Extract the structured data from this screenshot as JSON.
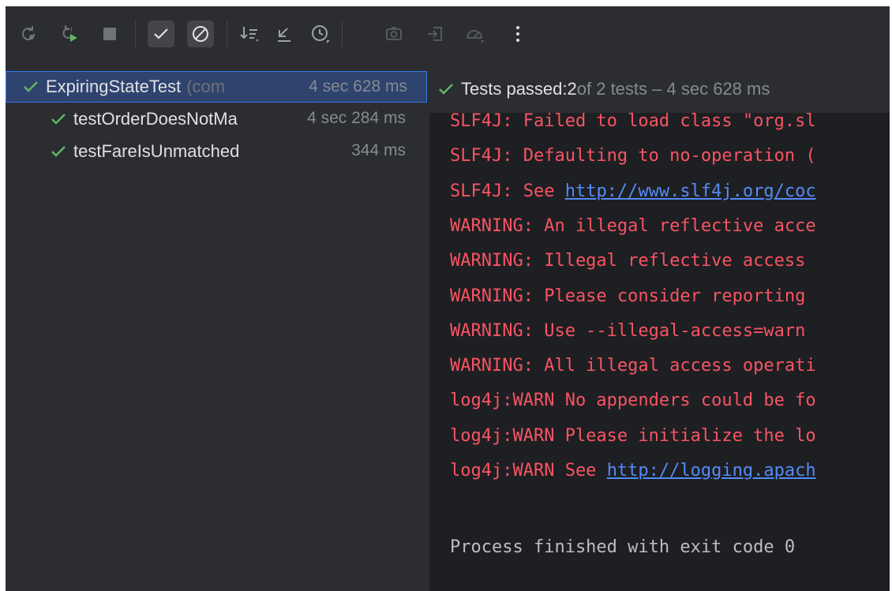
{
  "toolbar": {
    "buttons": [
      {
        "icon": "rerun-icon"
      },
      {
        "icon": "rerun-failed-icon"
      },
      {
        "icon": "stop-icon"
      },
      {
        "icon": "show-passed-icon",
        "active": true
      },
      {
        "icon": "show-ignored-icon",
        "active": true
      },
      {
        "icon": "sort-icon"
      },
      {
        "icon": "collapse-icon"
      },
      {
        "icon": "history-icon"
      },
      {
        "icon": "camera-icon"
      },
      {
        "icon": "import-icon"
      },
      {
        "icon": "gauge-icon"
      },
      {
        "icon": "more-icon"
      }
    ]
  },
  "tree": {
    "root": {
      "name": "ExpiringStateTest",
      "package": "(com",
      "time": "4 sec 628 ms"
    },
    "children": [
      {
        "name": "testOrderDoesNotMa",
        "time": "4 sec 284 ms"
      },
      {
        "name": "testFareIsUnmatched",
        "time": "344 ms"
      }
    ]
  },
  "status": {
    "prefix": "Tests passed: ",
    "passed": "2",
    "suffix": " of 2 tests – 4 sec 628 ms"
  },
  "console": {
    "lines": [
      {
        "text": "SLF4J: Failed to load class \"org.sl",
        "kind": "err"
      },
      {
        "text": "SLF4J: Defaulting to no-operation (",
        "kind": "err"
      },
      {
        "text": "SLF4J: See ",
        "link": "http://www.slf4j.org/coc",
        "kind": "err"
      },
      {
        "text": "WARNING: An illegal reflective acce",
        "kind": "err"
      },
      {
        "text": "WARNING: Illegal reflective access ",
        "kind": "err"
      },
      {
        "text": "WARNING: Please consider reporting ",
        "kind": "err"
      },
      {
        "text": "WARNING: Use --illegal-access=warn ",
        "kind": "err"
      },
      {
        "text": "WARNING: All illegal access operati",
        "kind": "err"
      },
      {
        "text": "log4j:WARN No appenders could be fo",
        "kind": "err"
      },
      {
        "text": "log4j:WARN Please initialize the lo",
        "kind": "err"
      },
      {
        "text": "log4j:WARN See ",
        "link": "http://logging.apach",
        "kind": "err"
      },
      {
        "text": "",
        "kind": "ok"
      },
      {
        "text": "Process finished with exit code 0",
        "kind": "ok"
      }
    ]
  },
  "colors": {
    "pass": "#5fb865",
    "error": "#f75464",
    "link": "#548af7",
    "selection": "#2e436e"
  }
}
